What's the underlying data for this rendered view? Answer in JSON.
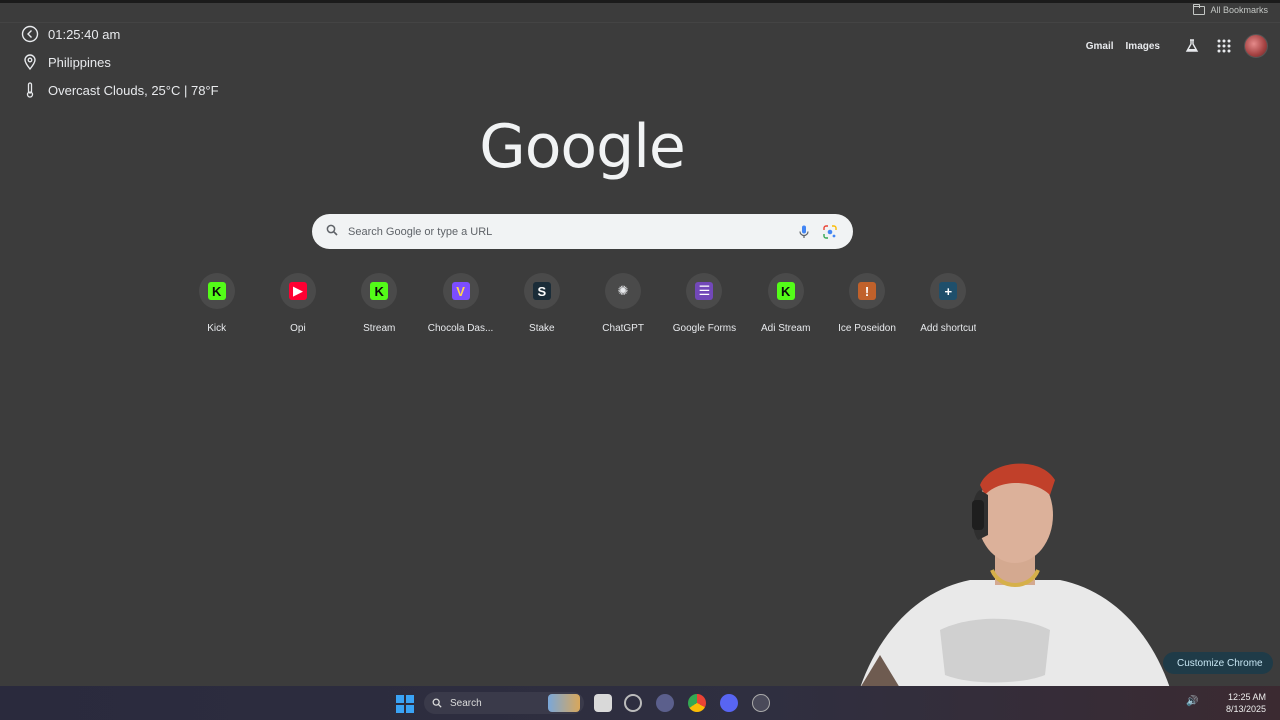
{
  "bookmarks_bar": {
    "all_bookmarks": "All Bookmarks"
  },
  "info_widget": {
    "time": "01:25:40 am",
    "location": "Philippines",
    "weather": "Overcast Clouds, 25°C | 78°F"
  },
  "header": {
    "gmail": "Gmail",
    "images": "Images",
    "icons": [
      "labs-flask-icon",
      "apps-grid-icon",
      "avatar"
    ]
  },
  "logo": "Google",
  "search": {
    "placeholder": "Search Google or type a URL"
  },
  "shortcuts": [
    {
      "label": "Kick",
      "icon": "K",
      "bg": "#53fc18",
      "fg": "#0b0b0b"
    },
    {
      "label": "Opi",
      "icon": "▶",
      "bg": "#ff0033",
      "fg": "#ffffff"
    },
    {
      "label": "Stream",
      "icon": "K",
      "bg": "#53fc18",
      "fg": "#0b0b0b"
    },
    {
      "label": "Chocola Das...",
      "icon": "V",
      "bg": "#7c4dff",
      "fg": "#ffd54f"
    },
    {
      "label": "Stake",
      "icon": "S",
      "bg": "#1a2c38",
      "fg": "#ffffff"
    },
    {
      "label": "ChatGPT",
      "icon": "✺",
      "bg": "#4a4a4a",
      "fg": "#e8eaed"
    },
    {
      "label": "Google Forms",
      "icon": "☰",
      "bg": "#7248b9",
      "fg": "#ffffff"
    },
    {
      "label": "Adi Stream",
      "icon": "K",
      "bg": "#53fc18",
      "fg": "#0b0b0b"
    },
    {
      "label": "Ice Poseidon",
      "icon": "!",
      "bg": "#c0612b",
      "fg": "#ffffff"
    },
    {
      "label": "Add shortcut",
      "icon": "+",
      "bg": "#1f4f6b",
      "fg": "#ffffff"
    }
  ],
  "customize": {
    "label": "Customize Chrome"
  },
  "taskbar": {
    "search_label": "Search",
    "clock_time": "12:25 AM",
    "clock_date": "8/13/2025"
  }
}
